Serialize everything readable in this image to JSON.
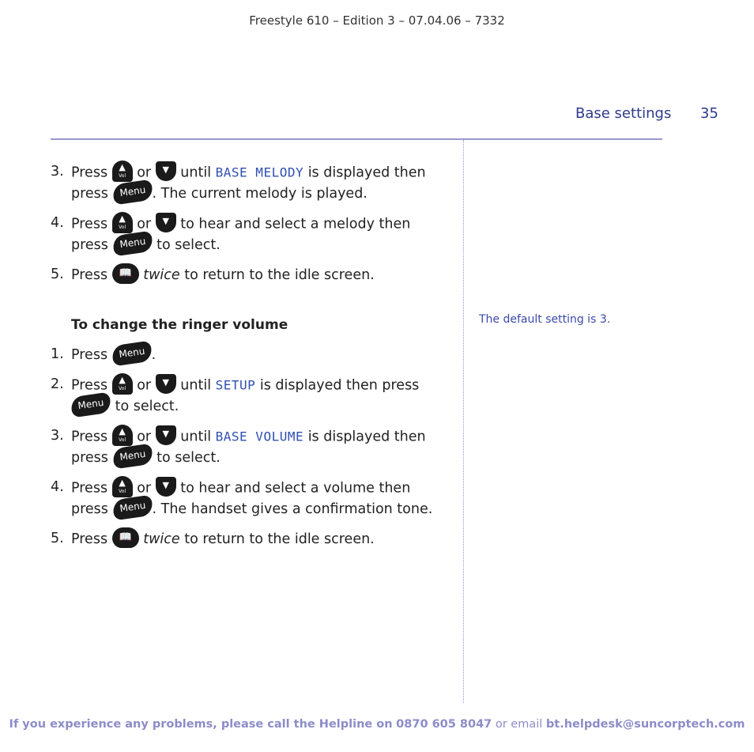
{
  "header": {
    "edition": "Freestyle 610 – Edition 3 – 07.04.06 – 7332",
    "section_title": "Base settings",
    "page_number": "35"
  },
  "keys": {
    "up_symbol": "▲",
    "up_label": "Vol",
    "down_symbol": "▼",
    "menu_label": "Menu",
    "book_symbol": "📖"
  },
  "melody_steps": [
    {
      "num": "3.",
      "w1": "Press",
      "w2": "or",
      "w3": "until",
      "lcd": "BASE MELODY",
      "w4": "is displayed then press",
      "w5": ". The current melody is played."
    },
    {
      "num": "4.",
      "w1": "Press",
      "w2": "or",
      "w3": "to hear and select a melody then press",
      "w4": "to select."
    },
    {
      "num": "5.",
      "w1": "Press",
      "em": "twice",
      "w2": "to return to the idle screen."
    }
  ],
  "volume_section": {
    "heading": "To change the ringer volume",
    "steps": [
      {
        "num": "1.",
        "w1": "Press",
        "w2": "."
      },
      {
        "num": "2.",
        "w1": "Press",
        "w2": "or",
        "w3": "until",
        "lcd": "SETUP",
        "w4": "is displayed then press",
        "w5": "to select."
      },
      {
        "num": "3.",
        "w1": "Press",
        "w2": "or",
        "w3": "until",
        "lcd": "BASE VOLUME",
        "w4": "is displayed then press",
        "w5": "to select."
      },
      {
        "num": "4.",
        "w1": "Press",
        "w2": "or",
        "w3": "to hear and select a volume then press",
        "w4": ". The handset gives a confirmation tone."
      },
      {
        "num": "5.",
        "w1": "Press",
        "em": "twice",
        "w2": "to return to the idle screen."
      }
    ]
  },
  "side_note": "The default setting is 3.",
  "footer": {
    "lead": "If you experience any problems, please call the Helpline on",
    "phone": "0870 605 8047",
    "mid": "or email",
    "email": "bt.helpdesk@suncorptech.com"
  }
}
